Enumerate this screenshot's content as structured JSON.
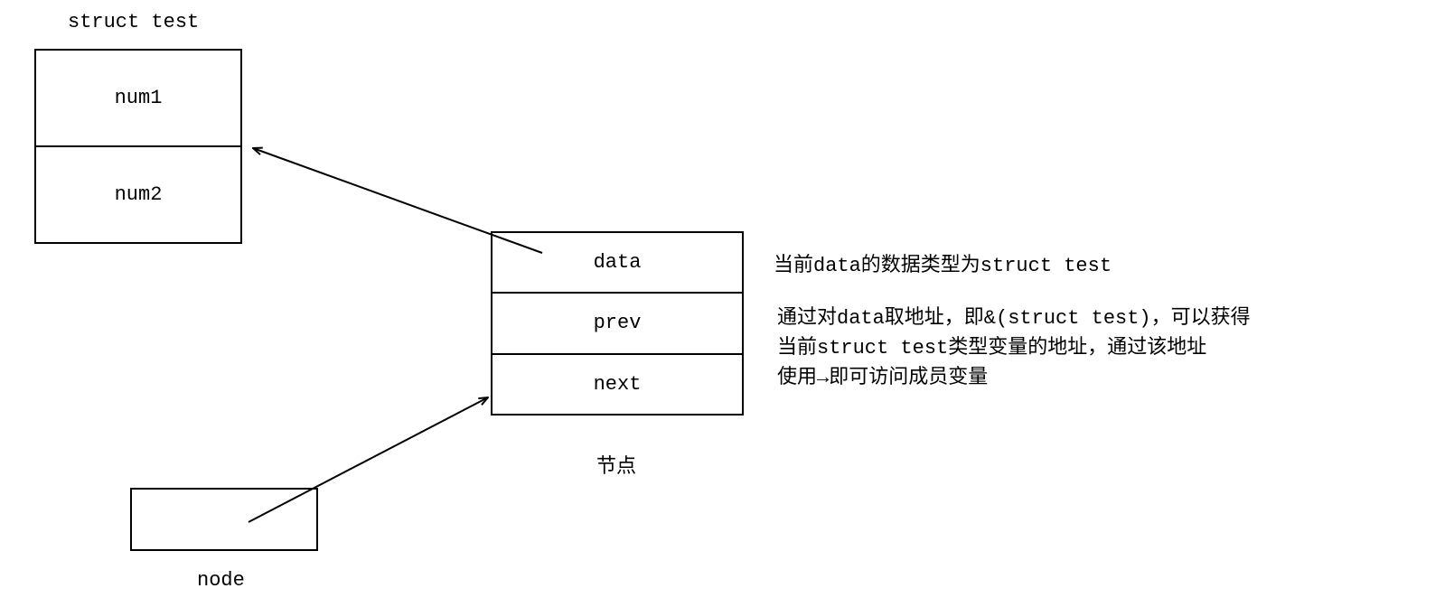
{
  "struct_label": "struct test",
  "struct_cells": {
    "num1": "num1",
    "num2": "num2"
  },
  "node_cells": {
    "data": "data",
    "prev": "prev",
    "next": "next"
  },
  "node_caption": "节点",
  "node_label": "node",
  "explain1": "当前data的数据类型为struct test",
  "explain2_line1": "通过对data取地址，即&(struct test)，可以获得",
  "explain2_line2": "当前struct test类型变量的地址，通过该地址",
  "explain2_line3": "使用→即可访问成员变量"
}
